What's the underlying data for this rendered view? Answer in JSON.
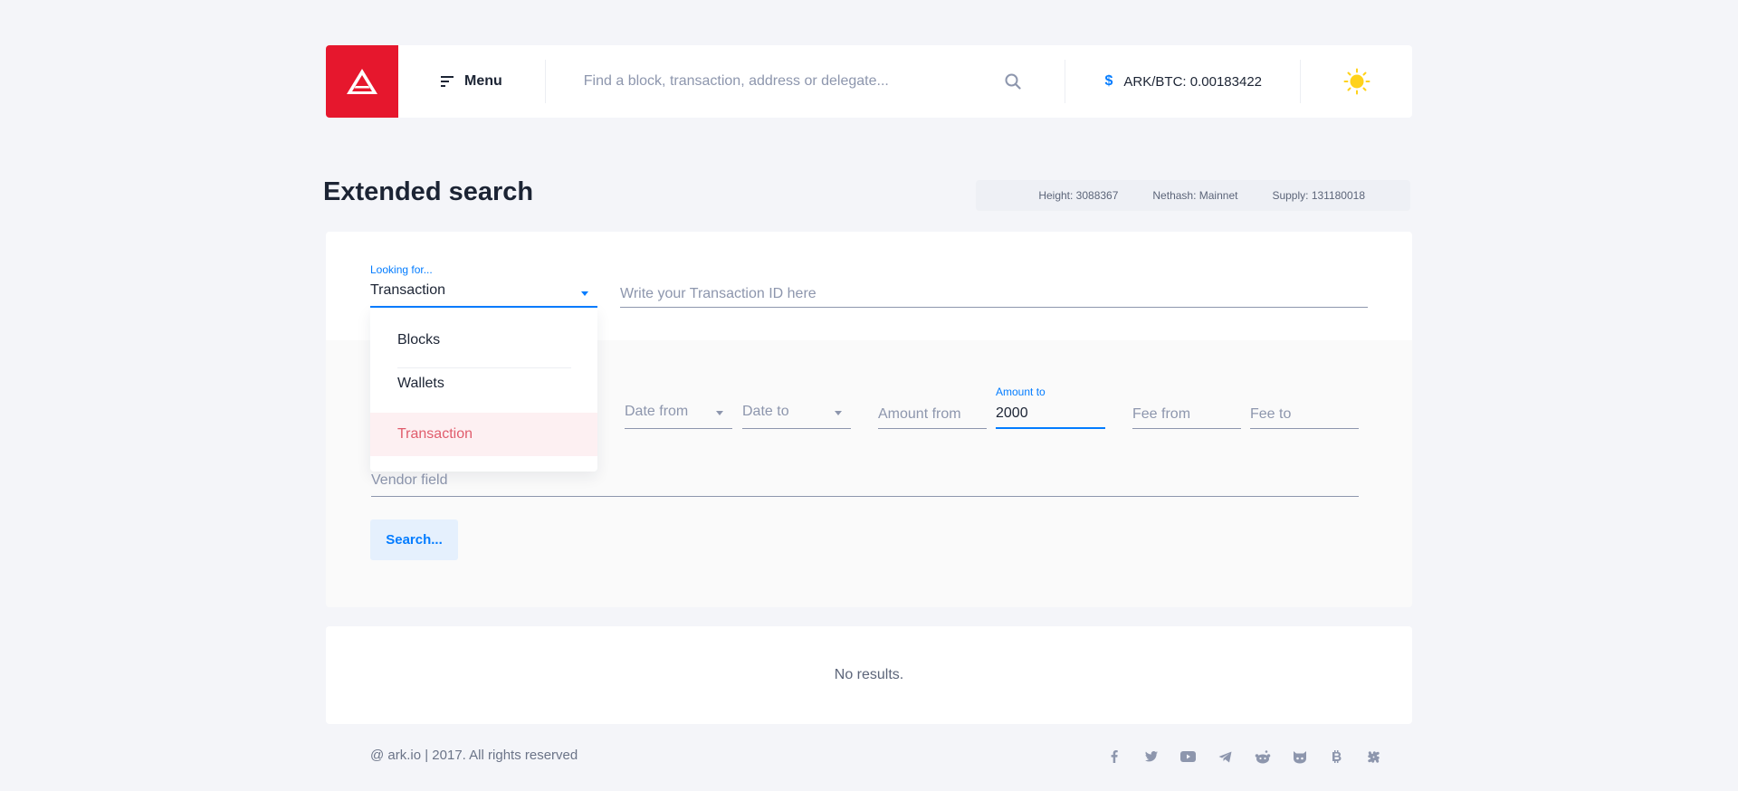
{
  "header": {
    "menu_label": "Menu",
    "search_placeholder": "Find a block, transaction, address or delegate...",
    "price_label": "ARK/BTC: 0.00183422",
    "currency_symbol": "$"
  },
  "page": {
    "title": "Extended search"
  },
  "stats": {
    "height": "Height: 3088367",
    "nethash": "Nethash: Mainnet",
    "supply": "Supply: 131180018"
  },
  "search_form": {
    "looking_for_label": "Looking for...",
    "looking_for_value": "Transaction",
    "tx_id_placeholder": "Write your Transaction ID here",
    "date_from": "Date from",
    "date_to": "Date to",
    "amount_from_placeholder": "Amount from",
    "amount_to_label": "Amount to",
    "amount_to_value": "2000",
    "fee_from_placeholder": "Fee from",
    "fee_to_placeholder": "Fee to",
    "vendor_placeholder": "Vendor field",
    "search_button": "Search..."
  },
  "dropdown": {
    "options": [
      "Blocks",
      "Wallets",
      "Transaction"
    ],
    "selected": "Transaction"
  },
  "results": {
    "empty_text": "No results."
  },
  "footer": {
    "copyright": "@ ark.io | 2017. All rights reserved",
    "socials": [
      "facebook-icon",
      "twitter-icon",
      "youtube-icon",
      "telegram-icon",
      "reddit-icon",
      "github-icon",
      "bitcointalk-icon",
      "slack-icon"
    ]
  },
  "colors": {
    "brand": "#e6172d",
    "accent": "#037cff",
    "sun": "#ffd21a"
  }
}
